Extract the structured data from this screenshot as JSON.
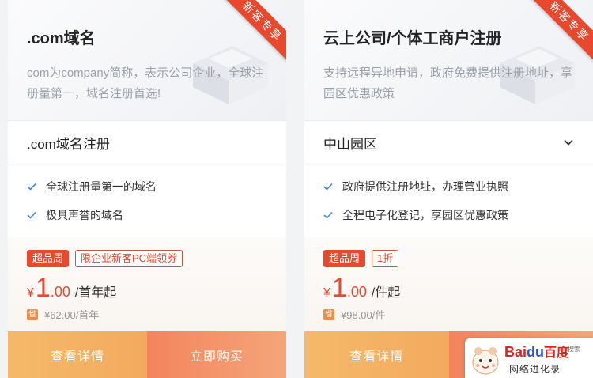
{
  "cards": [
    {
      "title": ".com域名",
      "ribbon": "新客专享",
      "description": "com为company简称，表示公司企业，全球注册量第一，域名注册首选!",
      "select_value": ".com域名注册",
      "features": [
        "全球注册量第一的域名",
        "极具声誉的域名"
      ],
      "badges": [
        "超品周",
        "限企业新客PC端领券"
      ],
      "price": {
        "currency": "¥",
        "int": "1",
        "dec": ".00",
        "unit": "/首年起"
      },
      "original_mark": "省",
      "original_price": "¥62.00/首年",
      "detail_label": "查看详情",
      "buy_label": "立即购买"
    },
    {
      "title": "云上公司/个体工商户注册",
      "ribbon": "新客专享",
      "description": "支持远程异地申请，政府免费提供注册地址，享园区优惠政策",
      "select_value": "中山园区",
      "features": [
        "政府提供注册地址，办理营业执照",
        "全程电子化登记，享园区优惠政策"
      ],
      "badges": [
        "超品周",
        "1折"
      ],
      "price": {
        "currency": "¥",
        "int": "1",
        "dec": ".00",
        "unit": "/件起"
      },
      "original_mark": "省",
      "original_price": "¥98.00/件",
      "detail_label": "查看详情"
    }
  ],
  "watermark": {
    "brand_bai": "Bai",
    "brand_du": "du",
    "brand_cn": "百度",
    "search": "搜索",
    "subtitle": "网络进化录"
  },
  "colors": {
    "accent": "#e8492e",
    "detail_button": "#f5b96a",
    "buy_button": "#f3845c"
  }
}
